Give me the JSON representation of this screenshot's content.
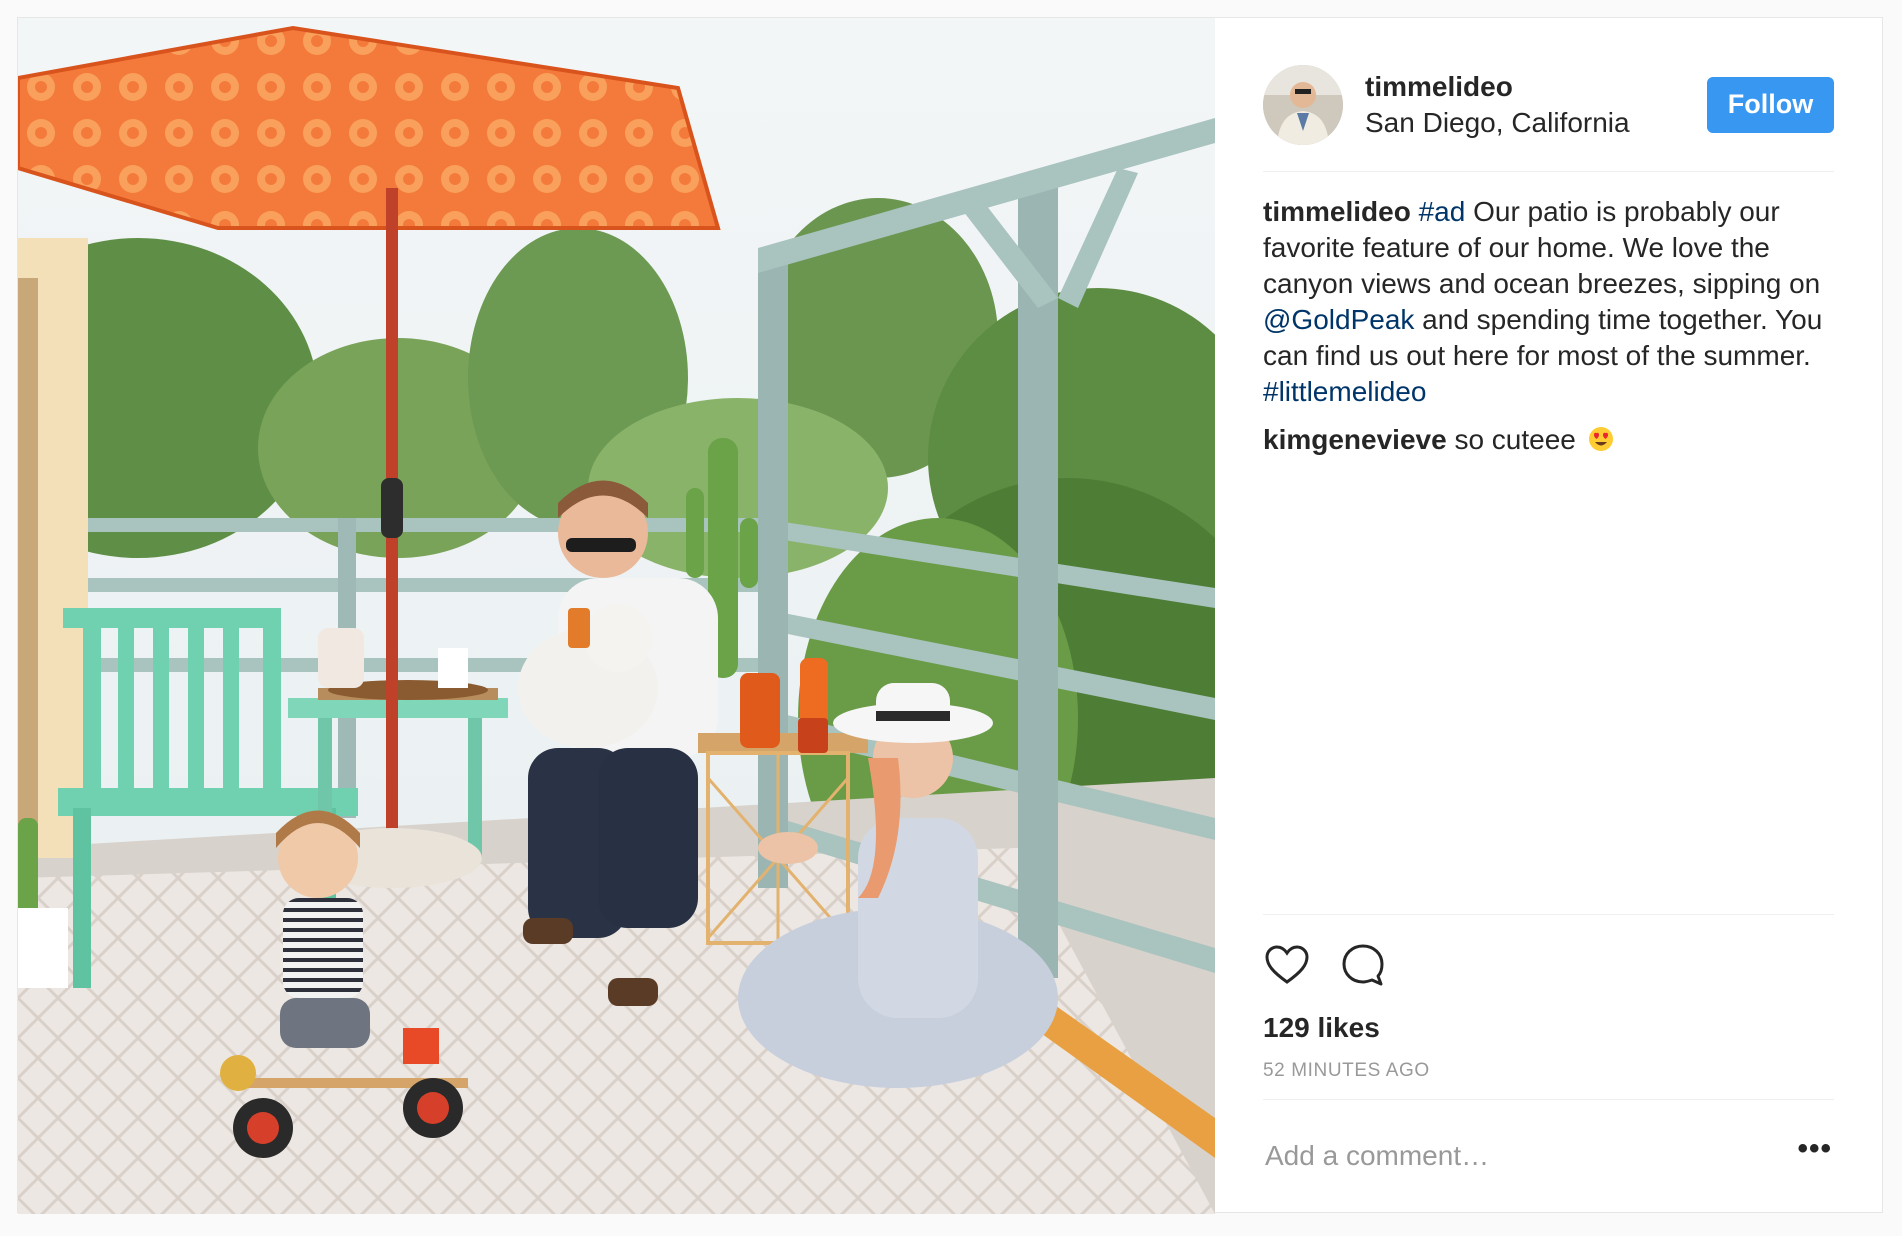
{
  "post": {
    "image_description_name": "patio-family-photo",
    "header": {
      "username": "timmelideo",
      "location": "San Diego, California",
      "follow_label": "Follow"
    },
    "caption": {
      "author": "timmelideo",
      "part1": "#ad",
      "part2": " Our patio is probably our favorite feature of our home. We love the canyon views and ocean breezes, sipping on ",
      "mention": "@GoldPeak",
      "part3": " and spending time together. You can find us out here for most of the summer. ",
      "hashtag": "#littlemelideo"
    },
    "comments": [
      {
        "author": "kimgenevieve",
        "text": " so cuteee",
        "emoji": "heart-eyes-emoji"
      }
    ],
    "actions": {
      "like_icon": "heart-icon",
      "comment_icon": "speech-bubble-icon"
    },
    "likes": "129 likes",
    "timestamp": "52 MINUTES AGO",
    "comment_input": {
      "placeholder": "Add a comment…"
    },
    "more_label": "•••"
  },
  "colors": {
    "follow_button": "#3897f0",
    "hashtag_link": "#003569",
    "umbrella": "#f26a2e",
    "railing": "#a9c3bf",
    "bench": "#6fd1b0"
  }
}
